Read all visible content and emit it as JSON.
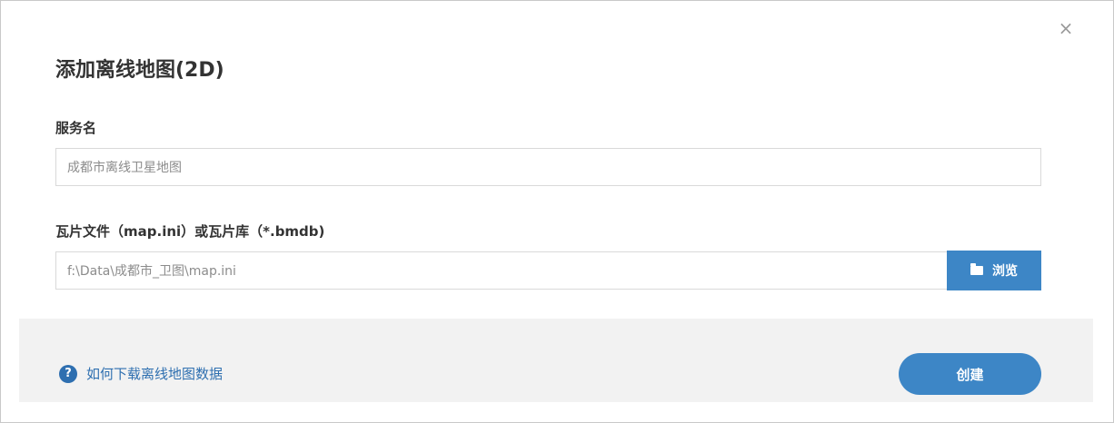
{
  "dialog": {
    "close_glyph": "×",
    "title": "添加离线地图(2D)",
    "service_name": {
      "label": "服务名",
      "value": "成都市离线卫星地图"
    },
    "tile_file": {
      "label": "瓦片文件（map.ini）或瓦片库（*.bmdb)",
      "value": "f:\\Data\\成都市_卫图\\map.ini",
      "browse_label": "浏览",
      "browse_icon": "folder-icon"
    },
    "footer": {
      "help_icon_glyph": "?",
      "help_link": "如何下载离线地图数据",
      "create_label": "创建"
    }
  },
  "colors": {
    "primary": "#3d86c6",
    "link": "#2e6fb0",
    "footer_bg": "#f2f2f2",
    "border": "#d9d9d9"
  }
}
